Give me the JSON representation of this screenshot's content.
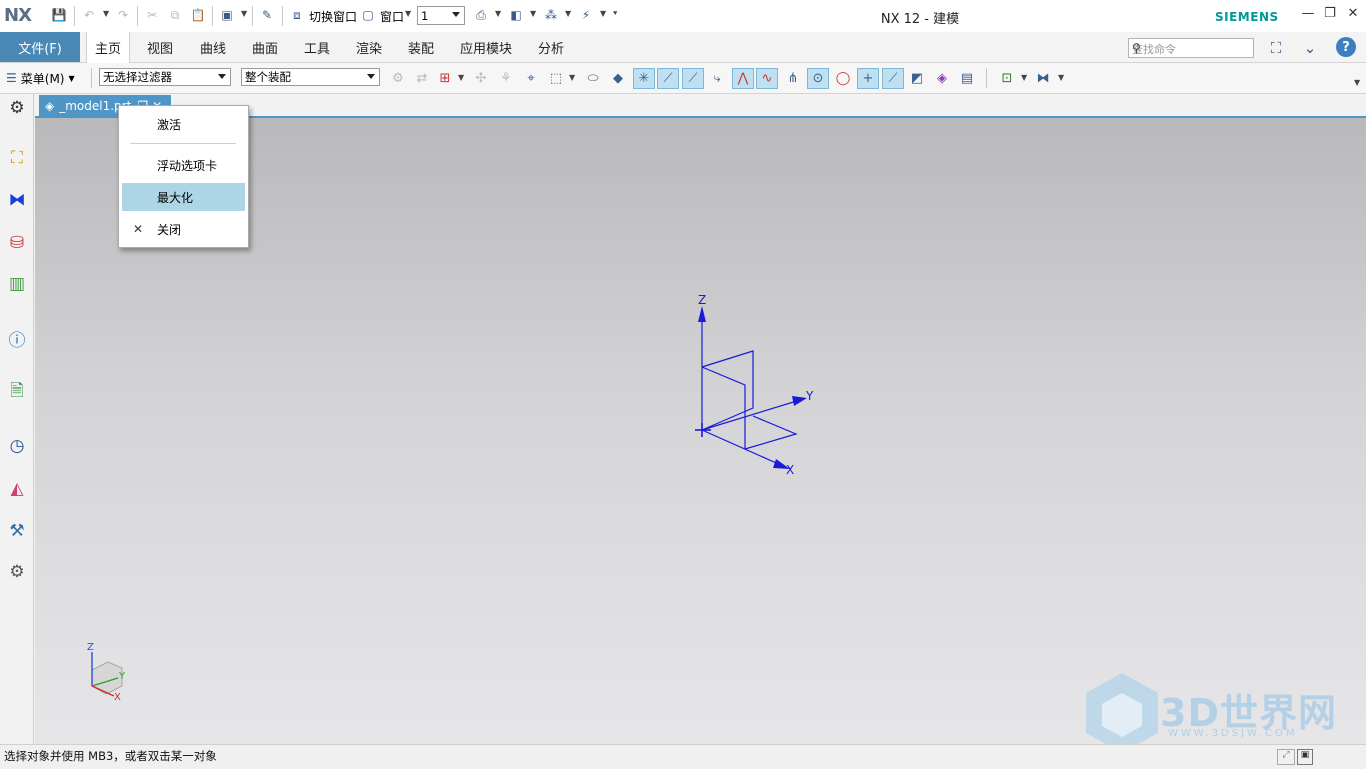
{
  "app": {
    "logo": "NX",
    "window_title": "NX 12 - 建模",
    "brand": "SIEMENS"
  },
  "quick_access": {
    "switch_window_label": "切换窗口",
    "window_label": "窗口",
    "window_number": "1"
  },
  "ribbon": {
    "file_label": "文件(F)",
    "tabs": [
      "主页",
      "视图",
      "曲线",
      "曲面",
      "工具",
      "渲染",
      "装配",
      "应用模块",
      "分析"
    ],
    "active_tab": "主页",
    "search_placeholder": "查找命令"
  },
  "toolbar": {
    "menu_label": "菜单(M)",
    "filter_value": "无选择过滤器",
    "assembly_value": "整个装配"
  },
  "document_tab": {
    "title": "_model1.prt"
  },
  "context_menu": {
    "items": [
      {
        "label": "激活",
        "icon": ""
      },
      {
        "label": "浮动选项卡",
        "icon": ""
      },
      {
        "label": "最大化",
        "icon": "",
        "highlighted": true
      },
      {
        "label": "关闭",
        "icon": "✕"
      }
    ]
  },
  "viewport": {
    "datum_labels": {
      "z": "Z",
      "y": "Y",
      "x": "X"
    },
    "triad_labels": {
      "z": "Z",
      "y": "Y",
      "x": "X"
    },
    "datum_color": "#1a1ad6"
  },
  "status": {
    "prompt": "选择对象并使用 MB3，或者双击某一对象"
  },
  "watermark": {
    "text": "3D世界网",
    "url": "WWW.3DSJW.COM"
  },
  "colors": {
    "accent": "#4a89b6",
    "doc_tab": "#4f96c7",
    "menu_highlight": "#acd6e5",
    "brand": "#009999"
  }
}
